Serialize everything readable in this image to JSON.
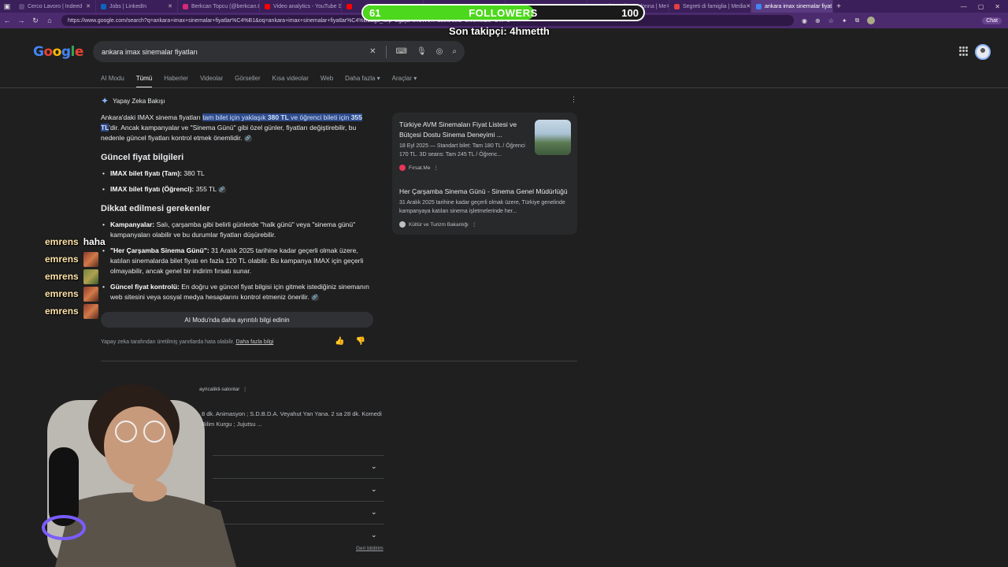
{
  "browser": {
    "tabs": [
      {
        "title": "Cerco Lavoro | Indeed",
        "color": "#5a4a7a",
        "active": false
      },
      {
        "title": "Jobs | LinkedIn",
        "color": "#0a66c2",
        "active": false
      },
      {
        "title": "Berkcan Topcu (@berkcan.t",
        "color": "#d62976",
        "active": false
      },
      {
        "title": "Video analytics - YouTube S",
        "color": "#ff0000",
        "active": false
      },
      {
        "title": "",
        "color": "#ff0000",
        "active": false
      },
      {
        "title": "",
        "color": "#777777",
        "active": false
      },
      {
        "title": "",
        "color": "#777777",
        "active": false
      },
      {
        "title": "La forza di una donna | Me",
        "color": "#777777",
        "active": false
      },
      {
        "title": "Segreti di famiglia | Media",
        "color": "#e04040",
        "active": false
      },
      {
        "title": "ankara imax sinemalar fiyat",
        "color": "#4285f4",
        "active": true
      }
    ],
    "url": "https://www.google.com/search?q=ankara+imax+sinemalar+fiyatlar%C4%B1&oq=ankara+imax+sinemalar+fiyatlar%C4%B1&gs_lcrp=EgZjaHJvbWU... &sourceid=chrome&ie=UTF-8",
    "chat_label": "Chat"
  },
  "overlay": {
    "followers_current": "61",
    "followers_label": "FOLLOWERS",
    "followers_goal": "100",
    "followers_progress": 0.61,
    "last_follower": "Son takipçi: 4hmetth"
  },
  "search": {
    "query": "ankara imax sinemalar fiyatları",
    "tabs": [
      "AI Modu",
      "Tümü",
      "Haberler",
      "Videolar",
      "Görseller",
      "Kısa videolar",
      "Web",
      "Daha fazla ▾",
      "Araçlar ▾"
    ],
    "active_tab": "Tümü"
  },
  "ai_overview": {
    "heading": "Yapay Zeka Bakışı",
    "intro_before": "Ankara'daki IMAX sinema fiyatları ",
    "intro_hl_a": "tam bilet için yaklaşık ",
    "intro_hl_b": "380 TL",
    "intro_hl_c": " ve öğrenci bileti için ",
    "intro_hl_d": "355 TL",
    "intro_after": "'dir. Ancak kampanyalar ve \"Sinema Günü\" gibi özel günler, fiyatları değiştirebilir, bu nedenle güncel fiyatları kontrol etmek önemlidir.",
    "section1_title": "Güncel fiyat bilgileri",
    "price_full_label": "IMAX bilet fiyatı (Tam):",
    "price_full_value": " 380 TL",
    "price_student_label": "IMAX bilet fiyatı (Öğrenci):",
    "price_student_value": " 355 TL",
    "section2_title": "Dikkat edilmesi gerekenler",
    "note1_label": "Kampanyalar:",
    "note1_text": " Salı, çarşamba gibi belirli günlerde \"halk günü\" veya \"sinema günü\" kampanyaları olabilir ve bu durumlar fiyatları düşürebilir.",
    "note2_label": "\"Her Çarşamba Sinema Günü\":",
    "note2_text": " 31 Aralık 2025 tarihine kadar geçerli olmak üzere, katılan sinemalarda bilet fiyatı en fazla 120 TL olabilir. Bu kampanya IMAX için geçerli olmayabilir, ancak genel bir indirim fırsatı sunar.",
    "note3_label": "Güncel fiyat kontrolü:",
    "note3_text": " En doğru ve güncel fiyat bilgisi için gitmek istediğiniz sinemanın web sitesini veya sosyal medya hesaplarını kontrol etmeniz önerilir.",
    "ai_mode_button": "AI Modu'nda daha ayrıntılı bilgi edinin",
    "disclaimer": "Yapay zeka tarafından üretilmiş yanıtlarda hata olabilir. ",
    "disclaimer_link": "Daha fazla bilgi"
  },
  "sources": [
    {
      "title": "Türkiye AVM Sinemaları Fiyat Listesi ve Bütçesi Dostu Sinema Deneyimi ...",
      "snippet": "18 Eyl 2025 — Standart bilet: Tam 180 TL / Öğrenci 170 TL. 3D seans: Tam 245 TL / Öğrenc...",
      "site": "Fırsat.Me",
      "color": "#e8355a"
    },
    {
      "title": "Her Çarşamba Sinema Günü - Sinema Genel Müdürlüğü",
      "snippet": "31 Aralık 2025 tarihine kadar geçerli olmak üzere, Türkiye genelinde kampanyaya katılan sinema işletmelerinde her...",
      "site": "Kültür ve Turizm Bakanlığı",
      "color": "#c0c0c0"
    }
  ],
  "result": {
    "site": "ayricalikli-salonlar",
    "snippet": "8 dk. Animasyon ; S.D.B.D.A. Veyahut Yan Yana. 2 sa 28 dk. Komedi Bilim Kurgu ; Jujutsu ..."
  },
  "feedback": "Geri bildirim",
  "chat": {
    "user": "emrens",
    "first_message": "haha",
    "lines": 5
  },
  "colors": {
    "page_bg": "#1f1f1f",
    "tab_bar": "#3a1f5a",
    "follower_fill": "#4cd81c",
    "highlight": "#2d4a8a"
  }
}
